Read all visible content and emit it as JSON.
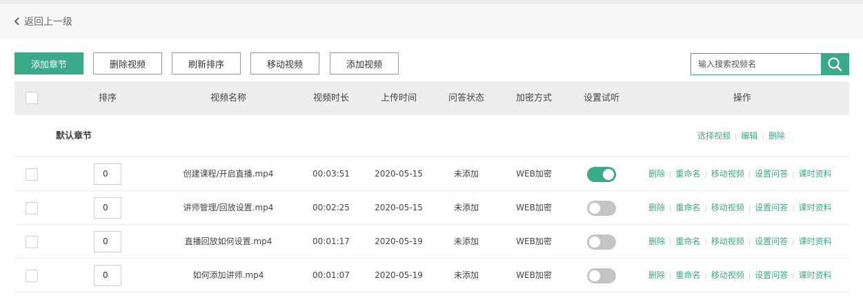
{
  "nav": {
    "back_label": "返回上一级"
  },
  "toolbar": {
    "add_chapter": "添加章节",
    "delete_video": "删除视频",
    "refresh_order": "刷新排序",
    "move_video": "移动视频",
    "add_video": "添加视频"
  },
  "search": {
    "placeholder": "输入搜索视频名"
  },
  "table": {
    "headers": {
      "order": "排序",
      "name": "视频名称",
      "duration": "视频时长",
      "upload_time": "上传时间",
      "qa_status": "问答状态",
      "encryption": "加密方式",
      "preview": "设置试听",
      "actions": "操作"
    },
    "chapter": {
      "title": "默认章节",
      "ops": [
        "选择视频",
        "编辑",
        "删除"
      ]
    },
    "row_ops": [
      "删除",
      "重命名",
      "移动视频",
      "设置问答",
      "课时资料"
    ],
    "rows": [
      {
        "order": "0",
        "name": "创建课程/开启直播.mp4",
        "duration": "00:03:51",
        "upload_time": "2020-05-15",
        "qa_status": "未添加",
        "encryption": "WEB加密",
        "preview_on": true
      },
      {
        "order": "0",
        "name": "讲师管理/回放设置.mp4",
        "duration": "00:02:25",
        "upload_time": "2020-05-15",
        "qa_status": "未添加",
        "encryption": "WEB加密",
        "preview_on": false
      },
      {
        "order": "0",
        "name": "直播回放如何设置.mp4",
        "duration": "00:01:17",
        "upload_time": "2020-05-19",
        "qa_status": "未添加",
        "encryption": "WEB加密",
        "preview_on": false
      },
      {
        "order": "0",
        "name": "如何添加讲师.mp4",
        "duration": "00:01:07",
        "upload_time": "2020-05-19",
        "qa_status": "未添加",
        "encryption": "WEB加密",
        "preview_on": false
      }
    ]
  },
  "colors": {
    "accent": "#3aaa88",
    "toggle_off": "#c4c4c4",
    "header_bg": "#eeeeee"
  },
  "icons": {
    "back": "chevron-left-icon",
    "search": "search-icon"
  }
}
